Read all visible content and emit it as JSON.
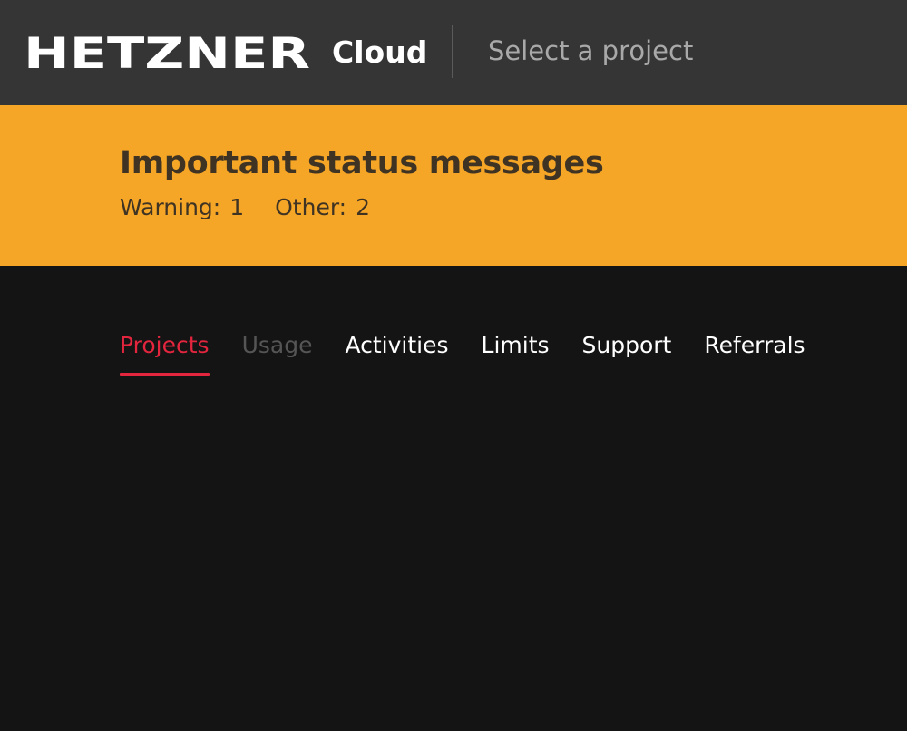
{
  "header": {
    "logo_text": "HETZNER",
    "product_label": "Cloud",
    "project_selector_placeholder": "Select a project"
  },
  "status_banner": {
    "title": "Important status messages",
    "warning_label": "Warning:",
    "warning_count": "1",
    "other_label": "Other:",
    "other_count": "2",
    "background_color": "#f5a626"
  },
  "tabs": [
    {
      "label": "Projects",
      "state": "active"
    },
    {
      "label": "Usage",
      "state": "disabled"
    },
    {
      "label": "Activities",
      "state": "normal"
    },
    {
      "label": "Limits",
      "state": "normal"
    },
    {
      "label": "Support",
      "state": "normal"
    },
    {
      "label": "Referrals",
      "state": "normal"
    }
  ],
  "colors": {
    "accent": "#e3253e",
    "header_bg": "#353535",
    "page_bg": "#141414"
  }
}
